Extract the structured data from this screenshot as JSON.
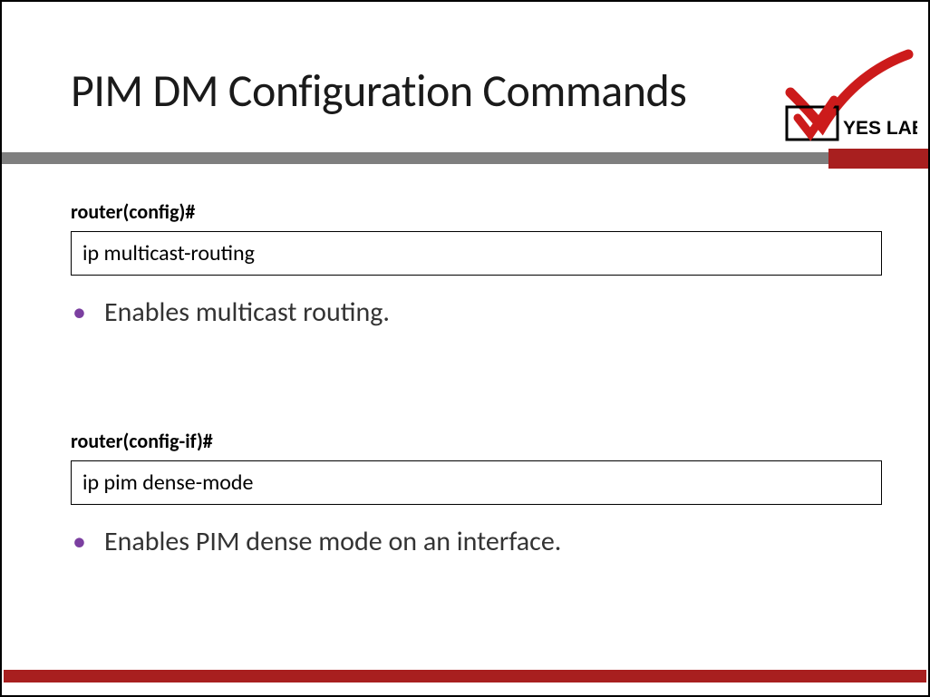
{
  "title": "PIM DM Configuration Commands",
  "logo_text": "YES LAB",
  "blocks": [
    {
      "prompt": "router(config)#",
      "command": "ip multicast-routing",
      "description": "Enables multicast routing."
    },
    {
      "prompt": "router(config-if)#",
      "command": "ip pim dense-mode",
      "description": "Enables PIM dense mode on an interface."
    }
  ],
  "colors": {
    "accent_red": "#a81f1f",
    "bullet_purple": "#7b3fa0",
    "divider_gray": "#7f7f7f"
  }
}
